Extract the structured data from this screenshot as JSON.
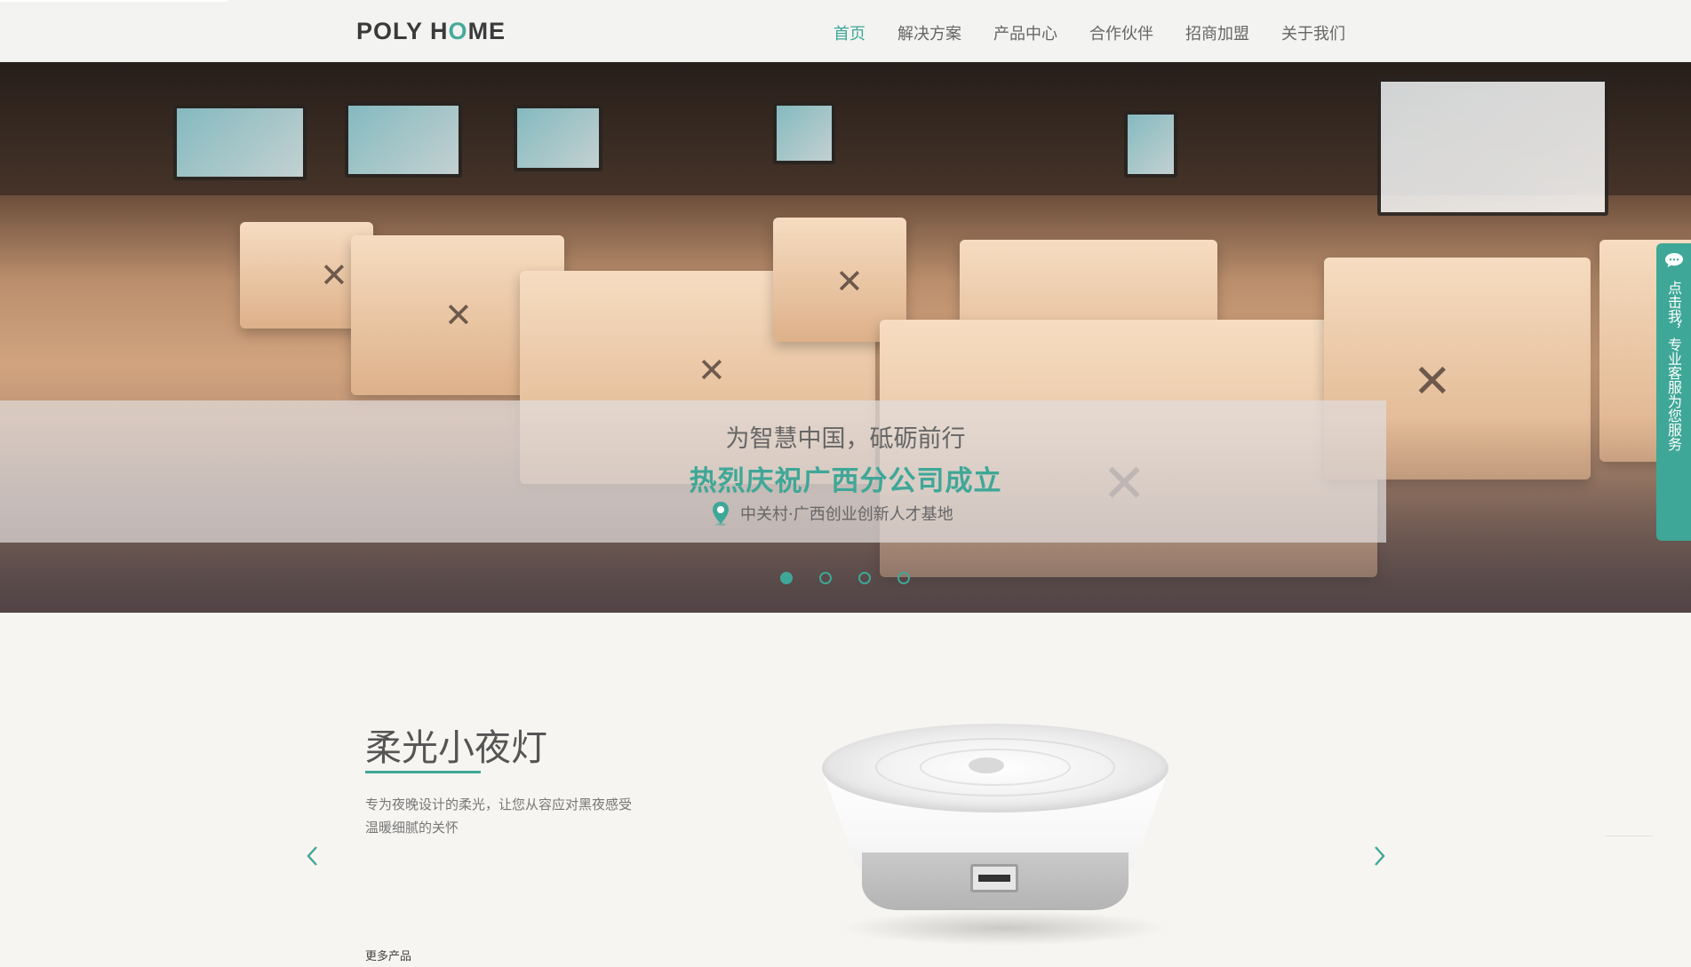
{
  "header": {
    "logo": {
      "part1": "POLY H",
      "part2": "O",
      "part3": "ME"
    },
    "nav": [
      {
        "label": "首页",
        "active": true
      },
      {
        "label": "解决方案",
        "active": false
      },
      {
        "label": "产品中心",
        "active": false
      },
      {
        "label": "合作伙伴",
        "active": false
      },
      {
        "label": "招商加盟",
        "active": false
      },
      {
        "label": "关于我们",
        "active": false
      }
    ]
  },
  "hero": {
    "line1": "为智慧中国，砥砺前行",
    "line2": "热烈庆祝广西分公司成立",
    "location": "中关村·广西创业创新人才基地",
    "slides": 4,
    "active_slide": 1
  },
  "service_tab": {
    "label": "点击我，专业客服为您服务"
  },
  "product": {
    "title": "柔光小夜灯",
    "description": "专为夜晚设计的柔光，让您从容应对黑夜感受温暖细腻的关怀",
    "more_label": "更多产品"
  },
  "colors": {
    "accent": "#3fa797",
    "header_bg": "#f3f3f2",
    "page_bg": "#f6f5f1"
  }
}
